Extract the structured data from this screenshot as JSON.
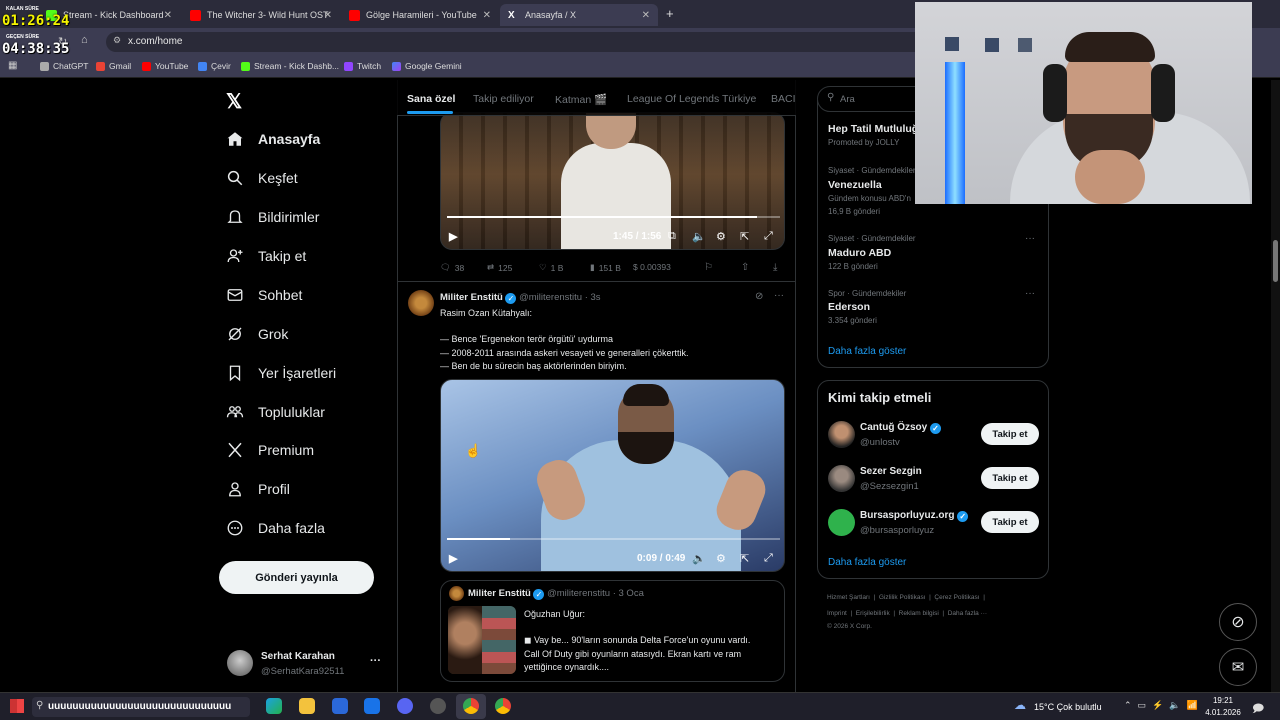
{
  "browser": {
    "tabs": [
      {
        "label": "Stream - Kick Dashboard",
        "color": "#53fc18"
      },
      {
        "label": "The Witcher 3- Wild Hunt OST",
        "color": "#ff0000"
      },
      {
        "label": "Gölge Haramileri - YouTube",
        "color": "#ff0000"
      },
      {
        "label": "Anasayfa / X",
        "color": "#ffffff"
      }
    ],
    "new_tab": "+",
    "url": "x.com/home",
    "bookmarks": [
      "ChatGPT",
      "Gmail",
      "YouTube",
      "Çevir",
      "Stream - Kick Dashb...",
      "Twitch",
      "Google Gemini"
    ]
  },
  "overlay": {
    "remaining_label": "KALAN SÜRE",
    "remaining_time": "01:26:24",
    "elapsed_label": "GEÇEN SÜRE",
    "elapsed_time": "04:38:35"
  },
  "nav": {
    "items": [
      "Anasayfa",
      "Keşfet",
      "Bildirimler",
      "Takip et",
      "Sohbet",
      "Grok",
      "Yer İşaretleri",
      "Topluluklar",
      "Premium",
      "Profil",
      "Daha fazla"
    ],
    "post_button": "Gönderi yayınla",
    "account_name": "Serhat Karahan",
    "account_handle": "@SerhatKara92511",
    "more": "···"
  },
  "feed": {
    "tabs": [
      "Sana özel",
      "Takip ediliyor",
      "Katman 🎬",
      "League Of Legends Türkiye",
      "BACIL"
    ],
    "video1": {
      "time": "1:45 / 1:56",
      "progress": 0.93
    },
    "actions1": {
      "replies": "38",
      "reposts": "125",
      "likes": "1 B",
      "views": "151 B",
      "price": "$ 0.00393"
    },
    "tweet": {
      "name": "Militer Enstitü",
      "handle": "@militerenstitu",
      "time": "· 3s",
      "line1": "Rasim Ozan Kütahyalı:",
      "line2": "— Bence 'Ergenekon terör örgütü' uydurma",
      "line3": "— 2008-2011 arasında askeri vesayeti ve generalleri çökerttik.",
      "line4": "— Ben de bu sürecin baş aktörlerinden biriyim."
    },
    "video2": {
      "time": "0:09 / 0:49",
      "progress": 0.19
    },
    "quote": {
      "name": "Militer Enstitü",
      "handle": "@militerenstitu",
      "time": "· 3 Oca",
      "line1": "Oğuzhan Uğur:",
      "line2": "◼ Vay be... 90'ların sonunda Delta Force'un oyunu vardı.",
      "line3": "Call Of Duty gibi oyunların atasıydı. Ekran kartı ve ram",
      "line4": "yettiğince oynardık...."
    }
  },
  "sidebar": {
    "search_placeholder": "Ara",
    "trends": [
      {
        "meta": "",
        "title": "Hep Tatil Mutluluğ",
        "sub": "Promoted by JOLLY"
      },
      {
        "meta": "Siyaset · Gündemdekiler",
        "title": "Venezuella",
        "sub": "Gündem konusu ABD'n",
        "count": "16,9 B gönderi"
      },
      {
        "meta": "Siyaset · Gündemdekiler",
        "title": "Maduro ABD",
        "count": "122 B gönderi"
      },
      {
        "meta": "Spor · Gündemdekiler",
        "title": "Ederson",
        "count": "3.354 gönderi"
      }
    ],
    "show_more": "Daha fazla göster",
    "who_title": "Kimi takip etmeli",
    "who": [
      {
        "name": "Cantuğ Özsoy",
        "handle": "@unlostv",
        "verified": true
      },
      {
        "name": "Sezer Sezgin",
        "handle": "@Sezsezgin1",
        "verified": false
      },
      {
        "name": "Bursasporluyuz.org",
        "handle": "@bursasporluyuz",
        "verified": true
      }
    ],
    "follow_label": "Takip et",
    "who_more": "Daha fazla göster",
    "footer1": [
      "Hizmet Şartları",
      "Gizlilik Politikası",
      "Çerez Politikası"
    ],
    "footer2": [
      "Imprint",
      "Erişilebilirlik",
      "Reklam bilgisi",
      "Daha fazla ···"
    ],
    "copyright": "© 2026 X Corp."
  },
  "taskbar": {
    "search_text": "uuuuuuuuuuuuuuuuuuuuuuuuuuuuuu",
    "weather": "15°C  Çok bulutlu",
    "time": "19:21",
    "date": "4.01.2026"
  }
}
